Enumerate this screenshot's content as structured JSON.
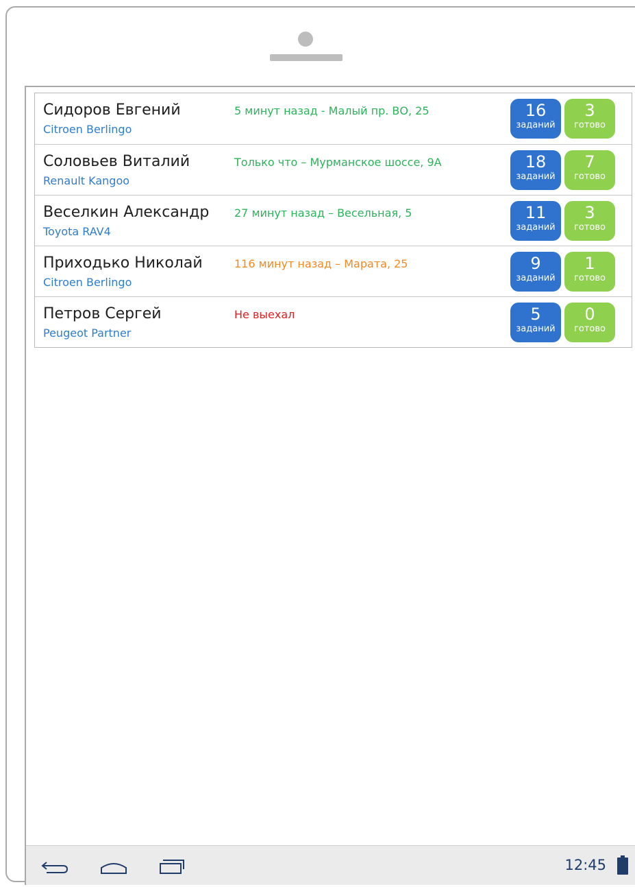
{
  "drivers": [
    {
      "name": "Сидоров Евгений",
      "car": "Citroen Berlingo",
      "status": "5 минут назад - Малый пр. ВО, 25",
      "status_color": "#2db35a",
      "tasks": "16",
      "tasks_label": "заданий",
      "done": "3",
      "done_label": "готово"
    },
    {
      "name": "Соловьев Виталий",
      "car": "Renault Kangoo",
      "status": "Только что – Мурманское шоссе, 9А",
      "status_color": "#2db35a",
      "tasks": "18",
      "tasks_label": "заданий",
      "done": "7",
      "done_label": "готово"
    },
    {
      "name": "Веселкин Александр",
      "car": "Toyota RAV4",
      "status": "27 минут назад – Весельная, 5",
      "status_color": "#2db35a",
      "tasks": "11",
      "tasks_label": "заданий",
      "done": "3",
      "done_label": "готово"
    },
    {
      "name": "Приходько Николай",
      "car": "Citroen Berlingo",
      "status": "116 минут назад – Марата, 25",
      "status_color": "#f08a24",
      "tasks": "9",
      "tasks_label": "заданий",
      "done": "1",
      "done_label": "готово"
    },
    {
      "name": "Петров Сергей",
      "car": "Peugeot Partner",
      "status": "Не выехал",
      "status_color": "#e02020",
      "tasks": "5",
      "tasks_label": "заданий",
      "done": "0",
      "done_label": "готово"
    }
  ],
  "colors": {
    "tasks_badge": "#2f73cf",
    "done_badge": "#8fd14f",
    "car_model": "#2e7dcc"
  },
  "navbar": {
    "icons": [
      "back-icon",
      "home-icon",
      "recent-apps-icon",
      "battery-icon"
    ],
    "clock": "12:45"
  }
}
